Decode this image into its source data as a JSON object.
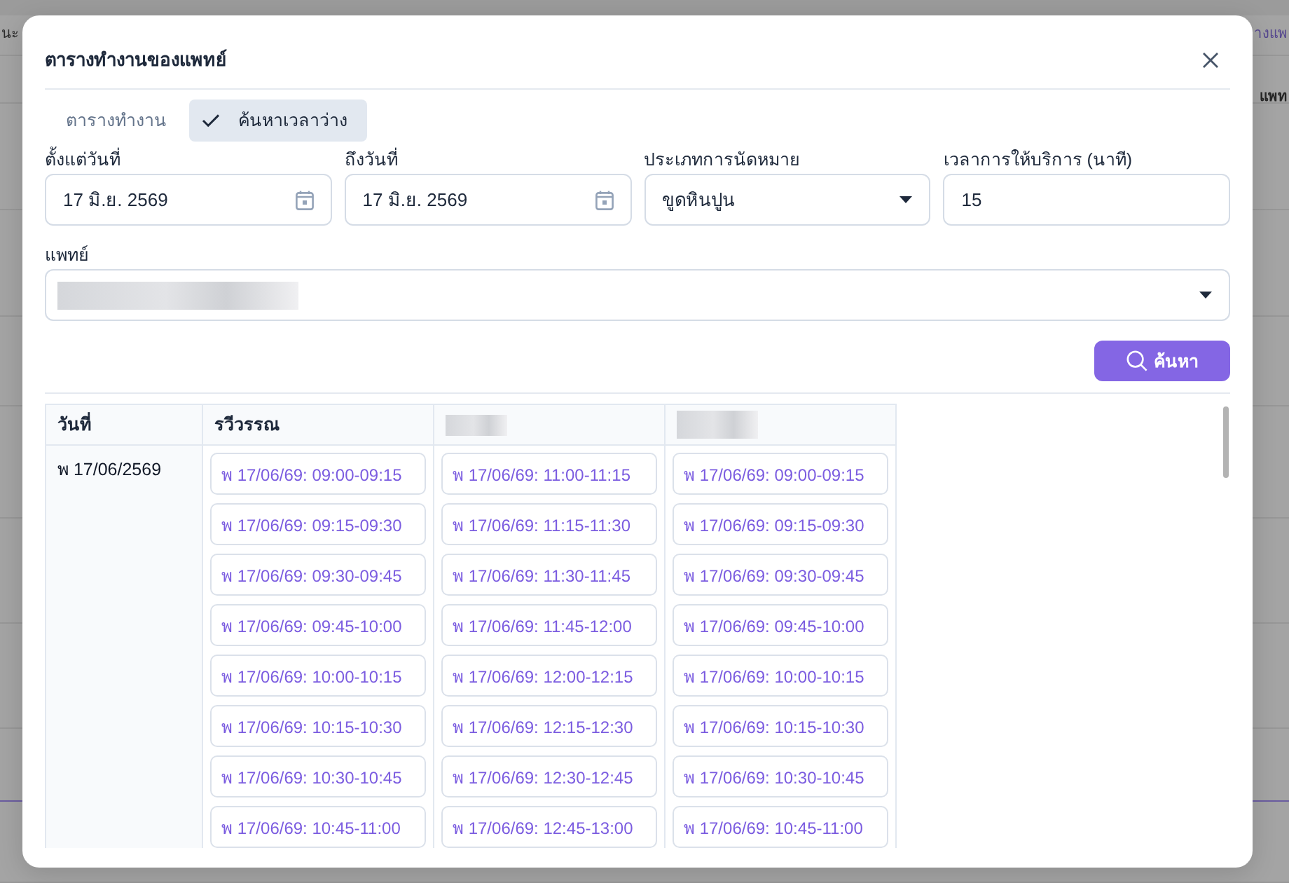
{
  "background": {
    "left_cell": "นะ",
    "right_link": "างแพ",
    "right_header": "แพท"
  },
  "dialog": {
    "title": "ตารางทำงานของแพทย์"
  },
  "tabs": [
    {
      "label": "ตารางทำงาน",
      "selected": false
    },
    {
      "label": "ค้นหาเวลาว่าง",
      "selected": true
    }
  ],
  "filters": [
    {
      "label": "ตั้งแต่วันที่",
      "kind": "date",
      "value": "17 มิ.ย. 2569"
    },
    {
      "label": "ถึงวันที่",
      "kind": "date",
      "value": "17 มิ.ย. 2569"
    },
    {
      "label": "ประเภทการนัดหมาย",
      "kind": "select",
      "value": "ขูดหินปูน"
    },
    {
      "label": "เวลาการให้บริการ (นาที)",
      "kind": "number",
      "value": "15"
    }
  ],
  "doctor_field": {
    "label": "แพทย์",
    "kind": "select",
    "redacted": true
  },
  "search_button": {
    "label": "ค้นหา"
  },
  "table": {
    "columns": [
      {
        "kind": "text",
        "label": "วันที่"
      },
      {
        "kind": "text",
        "label": "รวีวรรณ"
      },
      {
        "kind": "redacted"
      },
      {
        "kind": "redacted"
      }
    ],
    "rows": [
      {
        "date": "พ 17/06/2569",
        "slots": [
          [
            "พ 17/06/69: 09:00-09:15",
            "พ 17/06/69: 09:15-09:30",
            "พ 17/06/69: 09:30-09:45",
            "พ 17/06/69: 09:45-10:00",
            "พ 17/06/69: 10:00-10:15",
            "พ 17/06/69: 10:15-10:30",
            "พ 17/06/69: 10:30-10:45",
            "พ 17/06/69: 10:45-11:00"
          ],
          [
            "พ 17/06/69: 11:00-11:15",
            "พ 17/06/69: 11:15-11:30",
            "พ 17/06/69: 11:30-11:45",
            "พ 17/06/69: 11:45-12:00",
            "พ 17/06/69: 12:00-12:15",
            "พ 17/06/69: 12:15-12:30",
            "พ 17/06/69: 12:30-12:45",
            "พ 17/06/69: 12:45-13:00"
          ],
          [
            "พ 17/06/69: 09:00-09:15",
            "พ 17/06/69: 09:15-09:30",
            "พ 17/06/69: 09:30-09:45",
            "พ 17/06/69: 09:45-10:00",
            "พ 17/06/69: 10:00-10:15",
            "พ 17/06/69: 10:15-10:30",
            "พ 17/06/69: 10:30-10:45",
            "พ 17/06/69: 10:45-11:00"
          ]
        ]
      }
    ]
  }
}
